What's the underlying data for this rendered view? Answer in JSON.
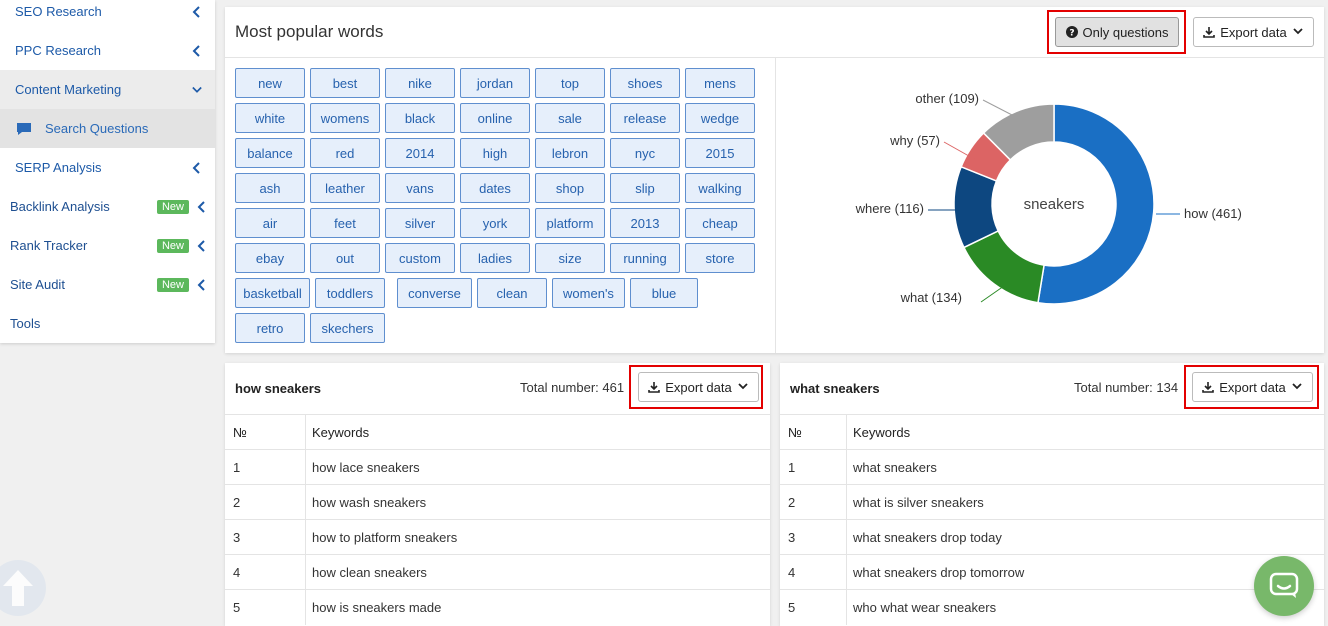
{
  "sidebar": {
    "items": [
      {
        "label": "SEO Research"
      },
      {
        "label": "PPC Research"
      },
      {
        "label": "Content Marketing"
      },
      {
        "label": "Search Questions"
      },
      {
        "label": "SERP Analysis"
      },
      {
        "label": "Backlink Analysis",
        "badge": "New"
      },
      {
        "label": "Rank Tracker",
        "badge": "New"
      },
      {
        "label": "Site Audit",
        "badge": "New"
      },
      {
        "label": "Tools"
      }
    ]
  },
  "top_panel": {
    "title": "Most popular words",
    "only_questions_label": "Only questions",
    "export_label": "Export data"
  },
  "tags": [
    "new",
    "best",
    "nike",
    "jordan",
    "top",
    "shoes",
    "mens",
    "white",
    "womens",
    "black",
    "online",
    "sale",
    "release",
    "wedge",
    "balance",
    "red",
    "2014",
    "high",
    "lebron",
    "nyc",
    "2015",
    "ash",
    "leather",
    "vans",
    "dates",
    "shop",
    "slip",
    "walking",
    "air",
    "feet",
    "silver",
    "york",
    "platform",
    "2013",
    "cheap",
    "ebay",
    "out",
    "custom",
    "ladies",
    "size",
    "running",
    "store",
    "basketball",
    "toddlers",
    "converse",
    "clean",
    "women's",
    "blue",
    "retro",
    "skechers"
  ],
  "chart_data": {
    "type": "pie",
    "center_label": "sneakers",
    "slices": [
      {
        "label": "how (461)",
        "name": "how",
        "value": 461,
        "color": "#1a6fc4"
      },
      {
        "label": "what (134)",
        "name": "what",
        "value": 134,
        "color": "#2a8a25"
      },
      {
        "label": "where (116)",
        "name": "where",
        "value": 116,
        "color": "#0d4780"
      },
      {
        "label": "why (57)",
        "name": "why",
        "value": 57,
        "color": "#dc6464"
      },
      {
        "label": "other (109)",
        "name": "other",
        "value": 109,
        "color": "#9e9e9e"
      }
    ]
  },
  "tables": [
    {
      "title": "how sneakers",
      "total": "Total number: 461",
      "export_label": "Export data",
      "col_num": "№",
      "col_kw": "Keywords",
      "rows": [
        {
          "n": "1",
          "kw": "how lace sneakers"
        },
        {
          "n": "2",
          "kw": "how wash sneakers"
        },
        {
          "n": "3",
          "kw": "how to platform sneakers"
        },
        {
          "n": "4",
          "kw": "how clean sneakers"
        },
        {
          "n": "5",
          "kw": "how is sneakers made"
        }
      ]
    },
    {
      "title": "what sneakers",
      "total": "Total number: 134",
      "export_label": "Export data",
      "col_num": "№",
      "col_kw": "Keywords",
      "rows": [
        {
          "n": "1",
          "kw": "what sneakers"
        },
        {
          "n": "2",
          "kw": "what is silver sneakers"
        },
        {
          "n": "3",
          "kw": "what sneakers drop today"
        },
        {
          "n": "4",
          "kw": "what sneakers drop tomorrow"
        },
        {
          "n": "5",
          "kw": "who what wear sneakers"
        }
      ]
    }
  ]
}
